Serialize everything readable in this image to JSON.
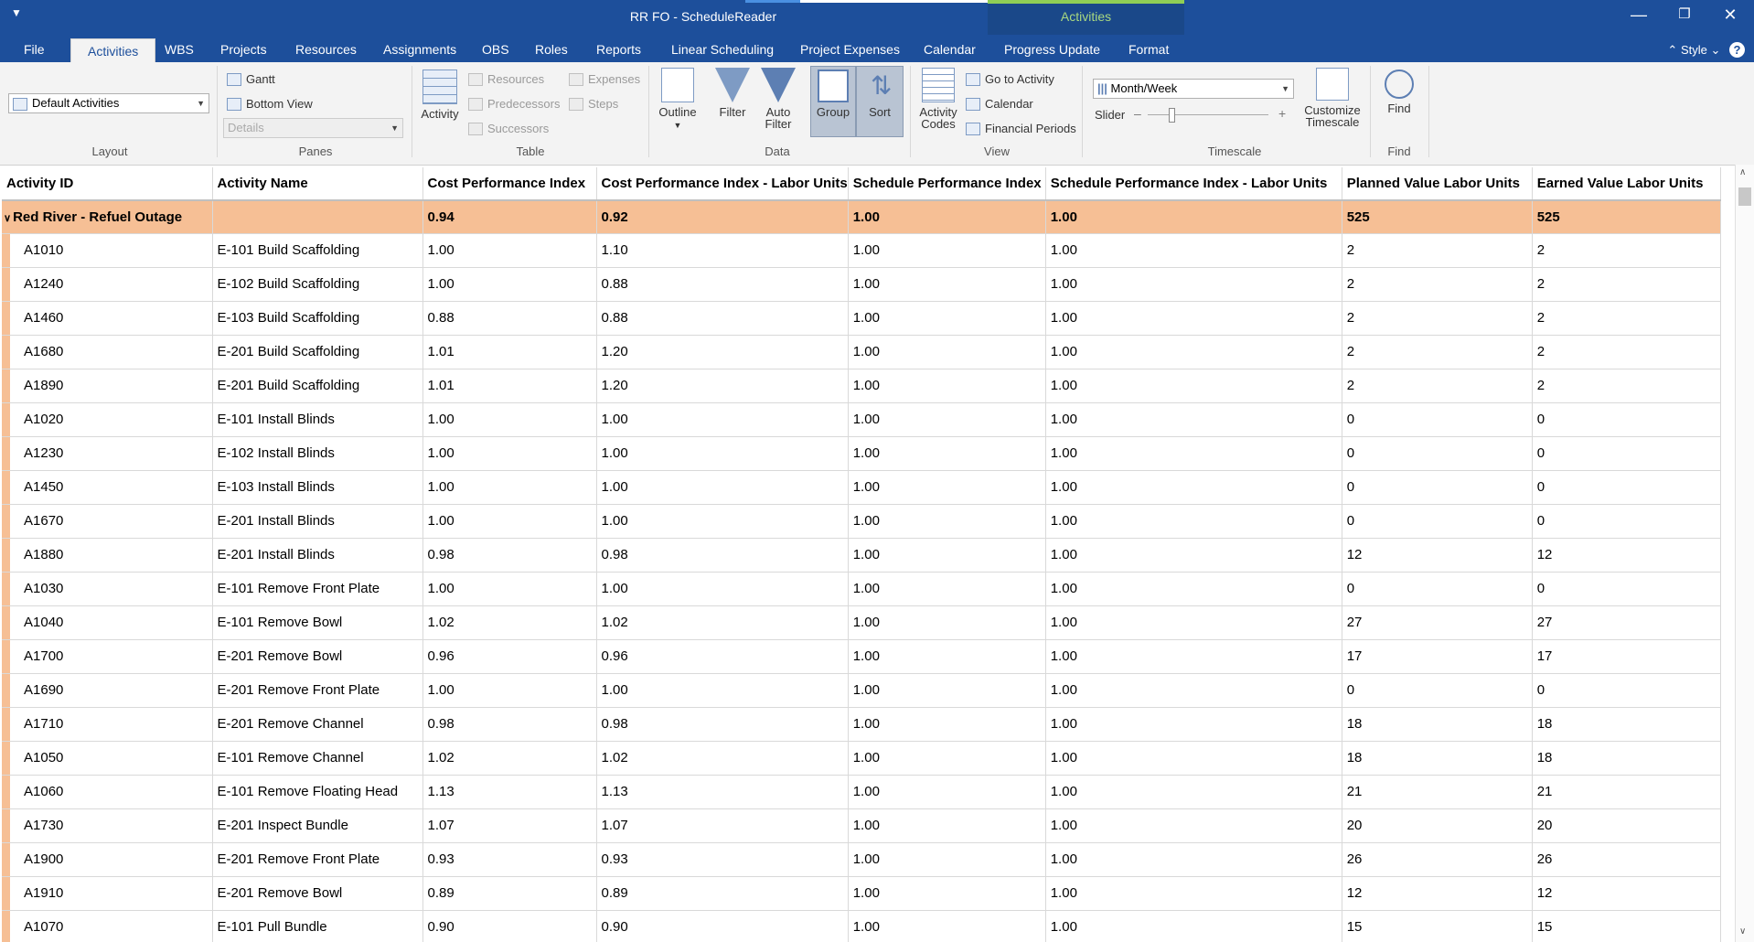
{
  "window": {
    "title": "RR FO - ScheduleReader",
    "context_label": "Activities"
  },
  "tabs": [
    "File",
    "Activities",
    "WBS",
    "Projects",
    "Resources",
    "Assignments",
    "OBS",
    "Roles",
    "Reports",
    "Linear Scheduling",
    "Project Expenses",
    "Calendar",
    "Progress Update",
    "Format"
  ],
  "style_label": "Style",
  "ribbon": {
    "layout": {
      "dropdown_value": "Default Activities",
      "label": "Layout"
    },
    "panes": {
      "gantt": "Gantt",
      "bottom_view": "Bottom View",
      "details": "Details",
      "label": "Panes"
    },
    "table": {
      "activity": "Activity",
      "resources": "Resources",
      "predecessors": "Predecessors",
      "successors": "Successors",
      "expenses": "Expenses",
      "steps": "Steps",
      "label": "Table"
    },
    "data": {
      "outline": "Outline",
      "filter": "Filter",
      "auto_filter_1": "Auto",
      "auto_filter_2": "Filter",
      "group": "Group",
      "sort": "Sort",
      "label": "Data"
    },
    "view": {
      "codes_1": "Activity",
      "codes_2": "Codes",
      "go_to": "Go to Activity",
      "calendar": "Calendar",
      "financial": "Financial Periods",
      "label": "View"
    },
    "timescale": {
      "dropdown_value": "Month/Week",
      "slider": "Slider",
      "label": "Timescale",
      "customize_1": "Customize",
      "customize_2": "Timescale"
    },
    "find": {
      "button": "Find",
      "label": "Find"
    }
  },
  "grid": {
    "columns": [
      "Activity ID",
      "Activity Name",
      "Cost Performance Index",
      "Cost Performance Index - Labor Units",
      "Schedule Performance Index",
      "Schedule Performance Index - Labor Units",
      "Planned Value Labor Units",
      "Earned Value Labor Units"
    ],
    "group_row": {
      "name": "Red River - Refuel Outage",
      "cpi": "0.94",
      "cpi_lu": "0.92",
      "spi": "1.00",
      "spi_lu": "1.00",
      "pv": "525",
      "ev": "525"
    },
    "rows": [
      [
        "A1010",
        "E-101 Build Scaffolding",
        "1.00",
        "1.10",
        "1.00",
        "1.00",
        "2",
        "2"
      ],
      [
        "A1240",
        "E-102 Build Scaffolding",
        "1.00",
        "0.88",
        "1.00",
        "1.00",
        "2",
        "2"
      ],
      [
        "A1460",
        "E-103 Build Scaffolding",
        "0.88",
        "0.88",
        "1.00",
        "1.00",
        "2",
        "2"
      ],
      [
        "A1680",
        "E-201 Build Scaffolding",
        "1.01",
        "1.20",
        "1.00",
        "1.00",
        "2",
        "2"
      ],
      [
        "A1890",
        "E-201 Build Scaffolding",
        "1.01",
        "1.20",
        "1.00",
        "1.00",
        "2",
        "2"
      ],
      [
        "A1020",
        "E-101 Install Blinds",
        "1.00",
        "1.00",
        "1.00",
        "1.00",
        "0",
        "0"
      ],
      [
        "A1230",
        "E-102 Install Blinds",
        "1.00",
        "1.00",
        "1.00",
        "1.00",
        "0",
        "0"
      ],
      [
        "A1450",
        "E-103 Install Blinds",
        "1.00",
        "1.00",
        "1.00",
        "1.00",
        "0",
        "0"
      ],
      [
        "A1670",
        "E-201 Install Blinds",
        "1.00",
        "1.00",
        "1.00",
        "1.00",
        "0",
        "0"
      ],
      [
        "A1880",
        "E-201 Install Blinds",
        "0.98",
        "0.98",
        "1.00",
        "1.00",
        "12",
        "12"
      ],
      [
        "A1030",
        "E-101 Remove Front Plate",
        "1.00",
        "1.00",
        "1.00",
        "1.00",
        "0",
        "0"
      ],
      [
        "A1040",
        "E-101 Remove Bowl",
        "1.02",
        "1.02",
        "1.00",
        "1.00",
        "27",
        "27"
      ],
      [
        "A1700",
        "E-201 Remove Bowl",
        "0.96",
        "0.96",
        "1.00",
        "1.00",
        "17",
        "17"
      ],
      [
        "A1690",
        "E-201 Remove Front Plate",
        "1.00",
        "1.00",
        "1.00",
        "1.00",
        "0",
        "0"
      ],
      [
        "A1710",
        "E-201 Remove Channel",
        "0.98",
        "0.98",
        "1.00",
        "1.00",
        "18",
        "18"
      ],
      [
        "A1050",
        "E-101 Remove Channel",
        "1.02",
        "1.02",
        "1.00",
        "1.00",
        "18",
        "18"
      ],
      [
        "A1060",
        "E-101 Remove Floating Head",
        "1.13",
        "1.13",
        "1.00",
        "1.00",
        "21",
        "21"
      ],
      [
        "A1730",
        "E-201 Inspect Bundle",
        "1.07",
        "1.07",
        "1.00",
        "1.00",
        "20",
        "20"
      ],
      [
        "A1900",
        "E-201 Remove Front Plate",
        "0.93",
        "0.93",
        "1.00",
        "1.00",
        "26",
        "26"
      ],
      [
        "A1910",
        "E-201 Remove Bowl",
        "0.89",
        "0.89",
        "1.00",
        "1.00",
        "12",
        "12"
      ],
      [
        "A1070",
        "E-101 Pull Bundle",
        "0.90",
        "0.90",
        "1.00",
        "1.00",
        "15",
        "15"
      ]
    ]
  }
}
